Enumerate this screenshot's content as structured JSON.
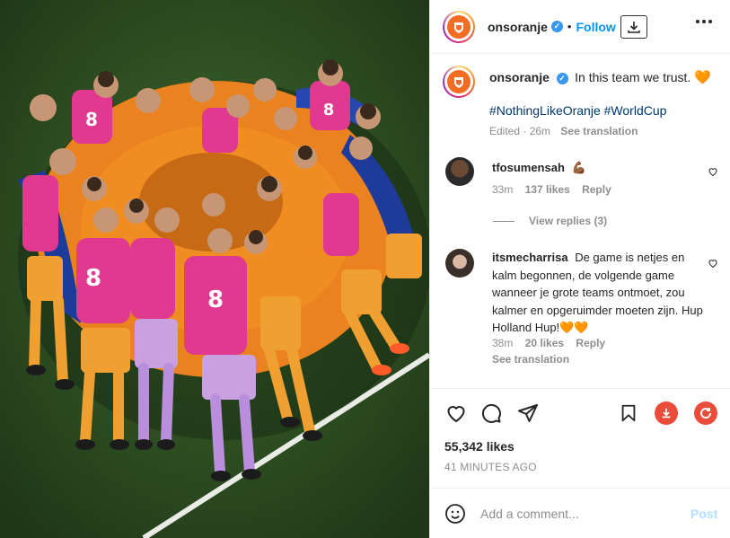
{
  "post": {
    "username": "onsoranje",
    "follow_label": "Follow",
    "dot": "•",
    "photo_alt": "Netherlands team huddle on the pitch"
  },
  "caption": {
    "username": "onsoranje",
    "text": "In this team we trust.",
    "emoji": "🧡",
    "hashtags": "#NothingLikeOranje #WorldCup",
    "edited": "Edited · 26m",
    "see_translation": "See translation"
  },
  "comments": [
    {
      "username": "tfosumensah",
      "text": "💪🏾",
      "time": "33m",
      "likes": "137 likes",
      "reply": "Reply"
    },
    {
      "username": "itsmecharrisa",
      "text": "De game is netjes en kalm begonnen, de volgende game wanneer je grote teams ontmoet, zou kalmer en opgeruimder moeten zijn. Hup Holland Hup!🧡🧡",
      "time": "38m",
      "likes": "20 likes",
      "reply": "Reply",
      "see_translation": "See translation"
    }
  ],
  "view_replies": "View replies (3)",
  "stats": {
    "likes": "55,342 likes",
    "posted": "41 MINUTES AGO"
  },
  "composer": {
    "placeholder": "Add a comment...",
    "post_label": "Post"
  },
  "colors": {
    "accent": "#0095f6",
    "brand_orange": "#f36c21",
    "muted": "#8e8e8e",
    "download_red": "#ea4c3a"
  },
  "icons": [
    "verified-icon",
    "download-icon",
    "more-icon",
    "heart-icon",
    "comment-icon",
    "share-icon",
    "bookmark-icon",
    "download-circle-icon",
    "refresh-icon",
    "emoji-icon"
  ]
}
